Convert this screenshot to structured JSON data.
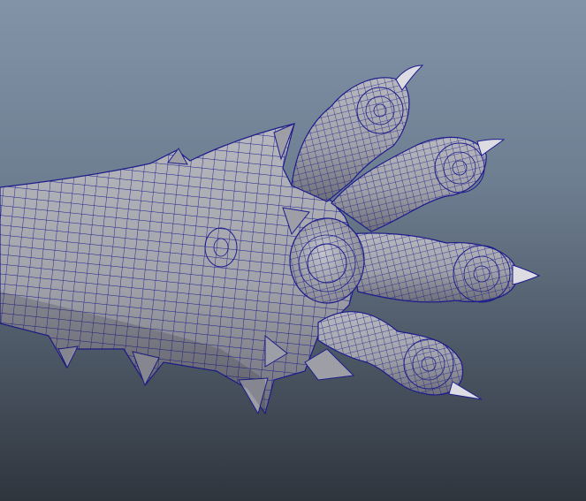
{
  "viewport": {
    "background_top": "#8293a8",
    "background_bottom": "#2f353d",
    "mesh_fill": "#a9a9b0",
    "mesh_shade": "#6d6e78",
    "wire_color": "#1c1c8c",
    "claw_tip": "#e8e8ec"
  },
  "model": {
    "subject": "creature-paw-icon",
    "display_mode": "wireframe-on-shaded"
  }
}
